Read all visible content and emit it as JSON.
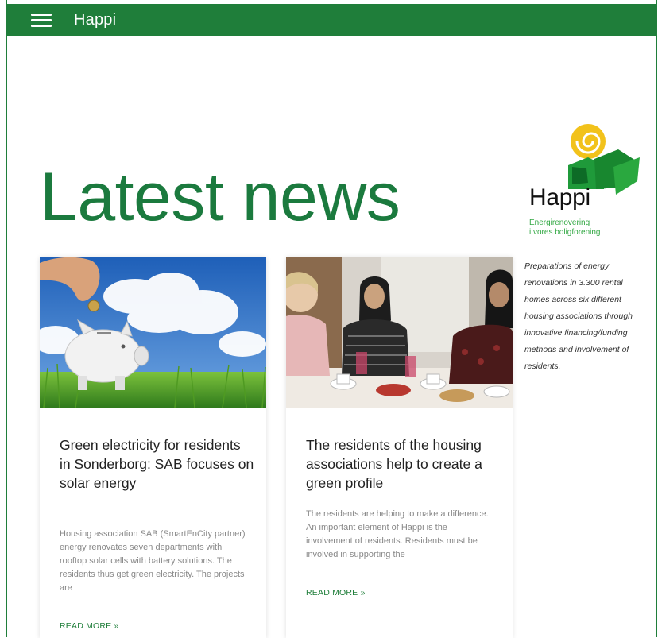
{
  "header": {
    "brand": "Happi",
    "menu_icon": "hamburger-menu-icon",
    "background": "#1f7e3a"
  },
  "hero": {
    "title": "Latest news",
    "color": "#1b7a3e"
  },
  "articles": [
    {
      "image": "piggy-bank-in-grass-photo",
      "title": "Green electricity for residents in Sonderborg: SAB focuses on solar energy",
      "excerpt": "Housing association SAB (SmartEnCity partner) energy renovates seven departments with rooftop solar cells with battery solutions. The residents thus get green electricity. The projects are",
      "read_more": "READ MORE »"
    },
    {
      "image": "residents-at-table-photo",
      "title": "The residents of the housing associations help to create a green profile",
      "excerpt": "The residents are helping to make a difference. An important element of Happi is the involvement of residents. Residents must be involved in supporting the",
      "read_more": "READ MORE »"
    }
  ],
  "sidebar": {
    "logo": {
      "word": "Happi",
      "subtitle_line1": "Energirenovering",
      "subtitle_line2": "i vores boligforening",
      "icon": "sun-spiral-and-green-buildings-icon"
    },
    "description": "Preparations of energy renovations in 3.300 rental homes across six different housing associations through innovative financing/funding methods and involvement of residents."
  },
  "colors": {
    "brand_green": "#1f7e3a",
    "logo_light_green": "#33a844",
    "logo_yellow": "#f2c21b"
  }
}
